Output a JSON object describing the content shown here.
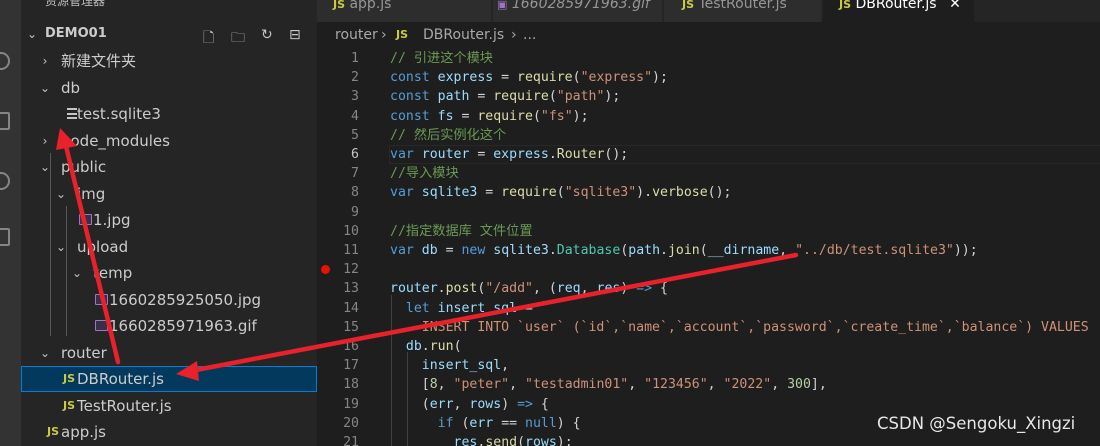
{
  "explorer": {
    "header_title": "资源管理器",
    "header_more": "···",
    "workspace": "DEMO01",
    "items": [
      {
        "label": "新建文件夹",
        "kind": "folder",
        "expanded": false
      },
      {
        "label": "db",
        "kind": "folder",
        "expanded": true
      },
      {
        "label": "test.sqlite3",
        "kind": "file-lines"
      },
      {
        "label": "node_modules",
        "kind": "folder",
        "expanded": false
      },
      {
        "label": "public",
        "kind": "folder",
        "expanded": true
      },
      {
        "label": "img",
        "kind": "folder",
        "expanded": true
      },
      {
        "label": "1.jpg",
        "kind": "image"
      },
      {
        "label": "upload",
        "kind": "folder",
        "expanded": true
      },
      {
        "label": "temp",
        "kind": "folder",
        "expanded": true
      },
      {
        "label": "1660285925050.jpg",
        "kind": "image"
      },
      {
        "label": "1660285971963.gif",
        "kind": "image"
      },
      {
        "label": "router",
        "kind": "folder",
        "expanded": true
      },
      {
        "label": "DBRouter.js",
        "kind": "js",
        "selected": true
      },
      {
        "label": "TestRouter.js",
        "kind": "js"
      },
      {
        "label": "app.js",
        "kind": "js"
      }
    ]
  },
  "icons": {
    "js_label": "JS",
    "chevron_right": "›",
    "chevron_down": "⌄",
    "new_file": "new-file-icon",
    "new_folder": "new-folder-icon",
    "refresh": "refresh-icon",
    "collapse": "collapse-all-icon",
    "close_glyph": "✕"
  },
  "tabs": [
    {
      "label": "app.js",
      "icon": "JS"
    },
    {
      "label": "1660285971963.gif",
      "icon": "▣"
    },
    {
      "label": "TestRouter.js",
      "icon": "JS"
    },
    {
      "label": "DBRouter.js",
      "icon": "JS",
      "active": true
    }
  ],
  "breadcrumb": {
    "folder": "router",
    "sep1": "›",
    "file_icon": "JS",
    "file": "DBRouter.js",
    "sep2": "›",
    "more": "..."
  },
  "editor": {
    "current_line": 6,
    "breakpoint_line": 12,
    "lines": [
      {
        "n": "1",
        "t": [
          [
            "cm",
            "// 引进这个模块"
          ]
        ]
      },
      {
        "n": "2",
        "t": [
          [
            "kw",
            "const "
          ],
          [
            "var",
            "express"
          ],
          [
            "",
            " = "
          ],
          [
            "fn",
            "require"
          ],
          [
            "",
            "("
          ],
          [
            "str",
            "\"express\""
          ],
          [
            "",
            ");"
          ]
        ]
      },
      {
        "n": "3",
        "t": [
          [
            "kw",
            "const "
          ],
          [
            "var",
            "path"
          ],
          [
            "",
            " = "
          ],
          [
            "fn",
            "require"
          ],
          [
            "",
            "("
          ],
          [
            "str",
            "\"path\""
          ],
          [
            "",
            ");"
          ]
        ]
      },
      {
        "n": "4",
        "t": [
          [
            "kw",
            "const "
          ],
          [
            "var",
            "fs"
          ],
          [
            "",
            " = "
          ],
          [
            "fn",
            "require"
          ],
          [
            "",
            "("
          ],
          [
            "str",
            "\"fs\""
          ],
          [
            "",
            ");"
          ]
        ]
      },
      {
        "n": "5",
        "t": [
          [
            "cm",
            "// 然后实例化这个"
          ]
        ]
      },
      {
        "n": "6",
        "t": [
          [
            "kw",
            "var "
          ],
          [
            "var",
            "router"
          ],
          [
            "",
            " = "
          ],
          [
            "var",
            "express"
          ],
          [
            "",
            "."
          ],
          [
            "fn",
            "Router"
          ],
          [
            "",
            "();"
          ]
        ]
      },
      {
        "n": "7",
        "t": [
          [
            "cm",
            "//导入模块"
          ]
        ]
      },
      {
        "n": "8",
        "t": [
          [
            "kw",
            "var "
          ],
          [
            "var",
            "sqlite3"
          ],
          [
            "",
            " = "
          ],
          [
            "fn",
            "require"
          ],
          [
            "",
            "("
          ],
          [
            "str",
            "\"sqlite3\""
          ],
          [
            "",
            ")."
          ],
          [
            "fn",
            "verbose"
          ],
          [
            "",
            "();"
          ]
        ]
      },
      {
        "n": "9",
        "t": []
      },
      {
        "n": "10",
        "t": [
          [
            "cm",
            "//指定数据库 文件位置"
          ]
        ]
      },
      {
        "n": "11",
        "t": [
          [
            "kw",
            "var "
          ],
          [
            "var",
            "db"
          ],
          [
            "",
            " = "
          ],
          [
            "kw",
            "new "
          ],
          [
            "var",
            "sqlite3"
          ],
          [
            "",
            "."
          ],
          [
            "cls",
            "Database"
          ],
          [
            "",
            "("
          ],
          [
            "var",
            "path"
          ],
          [
            "",
            "."
          ],
          [
            "fn",
            "join"
          ],
          [
            "",
            "("
          ],
          [
            "var",
            "__dirname"
          ],
          [
            "",
            ", "
          ],
          [
            "str",
            "\"../db/test.sqlite3\""
          ],
          [
            "",
            "));"
          ]
        ]
      },
      {
        "n": "12",
        "t": []
      },
      {
        "n": "13",
        "t": [
          [
            "var",
            "router"
          ],
          [
            "",
            "."
          ],
          [
            "fn",
            "post"
          ],
          [
            "",
            "("
          ],
          [
            "str",
            "\"/add\""
          ],
          [
            "",
            ", ("
          ],
          [
            "var",
            "req"
          ],
          [
            "",
            ", "
          ],
          [
            "var",
            "res"
          ],
          [
            "",
            ") "
          ],
          [
            "kw",
            "=>"
          ],
          [
            "",
            " {"
          ]
        ]
      },
      {
        "n": "14",
        "t": [
          [
            "",
            "  "
          ],
          [
            "kw",
            "let "
          ],
          [
            "var",
            "insert_sql"
          ],
          [
            "",
            " = "
          ],
          [
            "str",
            "`"
          ]
        ]
      },
      {
        "n": "15",
        "t": [
          [
            "str",
            "    INSERT INTO `user` (`id`,`name`,`account`,`password`,`create_time`,`balance`) VALUES"
          ]
        ]
      },
      {
        "n": "16",
        "t": [
          [
            "",
            "  "
          ],
          [
            "var",
            "db"
          ],
          [
            "",
            "."
          ],
          [
            "fn",
            "run"
          ],
          [
            "",
            "("
          ]
        ]
      },
      {
        "n": "17",
        "t": [
          [
            "",
            "    "
          ],
          [
            "var",
            "insert_sql"
          ],
          [
            "",
            ","
          ]
        ]
      },
      {
        "n": "18",
        "t": [
          [
            "",
            "    ["
          ],
          [
            "num",
            "8"
          ],
          [
            "",
            ", "
          ],
          [
            "str",
            "\"peter\""
          ],
          [
            "",
            ", "
          ],
          [
            "str",
            "\"testadmin01\""
          ],
          [
            "",
            ", "
          ],
          [
            "str",
            "\"123456\""
          ],
          [
            "",
            ", "
          ],
          [
            "str",
            "\"2022\""
          ],
          [
            "",
            ", "
          ],
          [
            "num",
            "300"
          ],
          [
            "",
            "],"
          ]
        ]
      },
      {
        "n": "19",
        "t": [
          [
            "",
            "    ("
          ],
          [
            "var",
            "err"
          ],
          [
            "",
            ", "
          ],
          [
            "var",
            "rows"
          ],
          [
            "",
            ") "
          ],
          [
            "kw",
            "=>"
          ],
          [
            "",
            " {"
          ]
        ]
      },
      {
        "n": "20",
        "t": [
          [
            "",
            "      "
          ],
          [
            "kw",
            "if"
          ],
          [
            "",
            " ("
          ],
          [
            "var",
            "err"
          ],
          [
            "",
            " == "
          ],
          [
            "kw",
            "null"
          ],
          [
            "",
            ") {"
          ]
        ]
      },
      {
        "n": "21",
        "t": [
          [
            "",
            "        "
          ],
          [
            "var",
            "res"
          ],
          [
            "",
            "."
          ],
          [
            "fn",
            "send"
          ],
          [
            "",
            "("
          ],
          [
            "var",
            "rows"
          ],
          [
            "",
            ");"
          ]
        ]
      }
    ]
  },
  "watermark": "CSDN @Sengoku_Xingzi",
  "colors": {
    "annotation_arrow": "#e8212b",
    "selection_bg": "#04395e",
    "breakpoint": "#e51400"
  }
}
